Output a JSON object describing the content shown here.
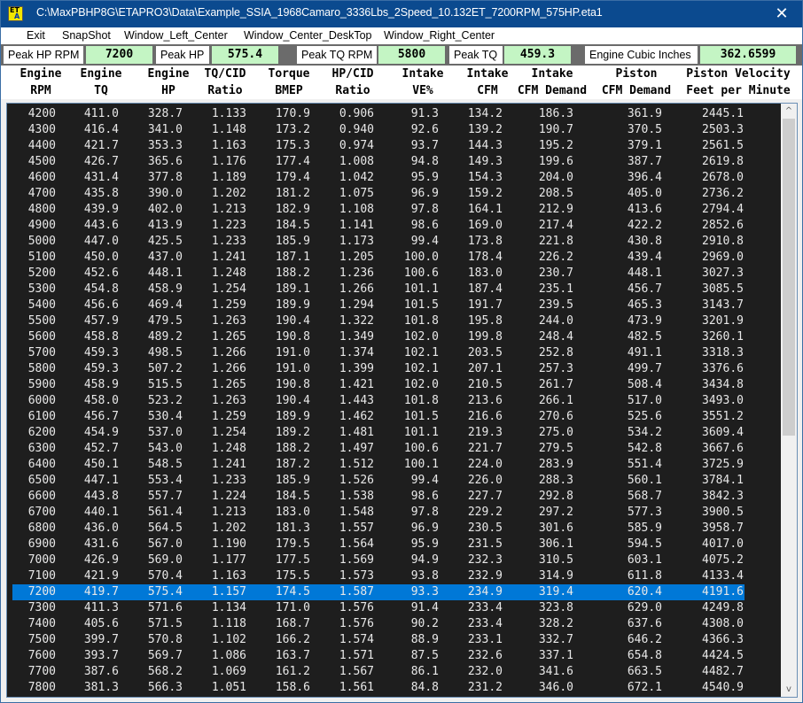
{
  "window": {
    "title": "C:\\MaxPBHP8G\\ETAPRO3\\Data\\Example_SSIA_1968Camaro_3336Lbs_2Speed_10.132ET_7200RPM_575HP.eta1",
    "icon_text_top": "ET",
    "icon_text_bottom": "A",
    "close_glyph": "✕"
  },
  "menu": [
    "Exit",
    "SnapShot",
    "Window_Left_Center",
    "Window_Center_DeskTop",
    "Window_Right_Center"
  ],
  "stats": [
    {
      "label": "Peak HP RPM",
      "value": "7200"
    },
    {
      "label": "Peak HP",
      "value": "575.4"
    },
    {
      "label": "Peak TQ RPM",
      "value": "5800"
    },
    {
      "label": "Peak TQ",
      "value": "459.3"
    },
    {
      "label": "Engine Cubic Inches",
      "value": "362.6599"
    }
  ],
  "columns": [
    {
      "line1": "Engine",
      "line2": "RPM"
    },
    {
      "line1": "Engine",
      "line2": "TQ"
    },
    {
      "line1": "Engine",
      "line2": "HP"
    },
    {
      "line1": "TQ/CID",
      "line2": "Ratio"
    },
    {
      "line1": "Torque",
      "line2": "BMEP"
    },
    {
      "line1": "HP/CID",
      "line2": "Ratio"
    },
    {
      "line1": "Intake",
      "line2": "VE%"
    },
    {
      "line1": "Intake",
      "line2": "CFM"
    },
    {
      "line1": "Intake",
      "line2": "CFM Demand"
    },
    {
      "line1": "Piston",
      "line2": "CFM Demand"
    },
    {
      "line1": "Piston Velocity",
      "line2": "Feet per Minute"
    }
  ],
  "selected_rpm": "7200",
  "rows": [
    [
      "4200",
      "411.0",
      "328.7",
      "1.133",
      "170.9",
      "0.906",
      "91.3",
      "134.2",
      "186.3",
      "361.9",
      "2445.1"
    ],
    [
      "4300",
      "416.4",
      "341.0",
      "1.148",
      "173.2",
      "0.940",
      "92.6",
      "139.2",
      "190.7",
      "370.5",
      "2503.3"
    ],
    [
      "4400",
      "421.7",
      "353.3",
      "1.163",
      "175.3",
      "0.974",
      "93.7",
      "144.3",
      "195.2",
      "379.1",
      "2561.5"
    ],
    [
      "4500",
      "426.7",
      "365.6",
      "1.176",
      "177.4",
      "1.008",
      "94.8",
      "149.3",
      "199.6",
      "387.7",
      "2619.8"
    ],
    [
      "4600",
      "431.4",
      "377.8",
      "1.189",
      "179.4",
      "1.042",
      "95.9",
      "154.3",
      "204.0",
      "396.4",
      "2678.0"
    ],
    [
      "4700",
      "435.8",
      "390.0",
      "1.202",
      "181.2",
      "1.075",
      "96.9",
      "159.2",
      "208.5",
      "405.0",
      "2736.2"
    ],
    [
      "4800",
      "439.9",
      "402.0",
      "1.213",
      "182.9",
      "1.108",
      "97.8",
      "164.1",
      "212.9",
      "413.6",
      "2794.4"
    ],
    [
      "4900",
      "443.6",
      "413.9",
      "1.223",
      "184.5",
      "1.141",
      "98.6",
      "169.0",
      "217.4",
      "422.2",
      "2852.6"
    ],
    [
      "5000",
      "447.0",
      "425.5",
      "1.233",
      "185.9",
      "1.173",
      "99.4",
      "173.8",
      "221.8",
      "430.8",
      "2910.8"
    ],
    [
      "5100",
      "450.0",
      "437.0",
      "1.241",
      "187.1",
      "1.205",
      "100.0",
      "178.4",
      "226.2",
      "439.4",
      "2969.0"
    ],
    [
      "5200",
      "452.6",
      "448.1",
      "1.248",
      "188.2",
      "1.236",
      "100.6",
      "183.0",
      "230.7",
      "448.1",
      "3027.3"
    ],
    [
      "5300",
      "454.8",
      "458.9",
      "1.254",
      "189.1",
      "1.266",
      "101.1",
      "187.4",
      "235.1",
      "456.7",
      "3085.5"
    ],
    [
      "5400",
      "456.6",
      "469.4",
      "1.259",
      "189.9",
      "1.294",
      "101.5",
      "191.7",
      "239.5",
      "465.3",
      "3143.7"
    ],
    [
      "5500",
      "457.9",
      "479.5",
      "1.263",
      "190.4",
      "1.322",
      "101.8",
      "195.8",
      "244.0",
      "473.9",
      "3201.9"
    ],
    [
      "5600",
      "458.8",
      "489.2",
      "1.265",
      "190.8",
      "1.349",
      "102.0",
      "199.8",
      "248.4",
      "482.5",
      "3260.1"
    ],
    [
      "5700",
      "459.3",
      "498.5",
      "1.266",
      "191.0",
      "1.374",
      "102.1",
      "203.5",
      "252.8",
      "491.1",
      "3318.3"
    ],
    [
      "5800",
      "459.3",
      "507.2",
      "1.266",
      "191.0",
      "1.399",
      "102.1",
      "207.1",
      "257.3",
      "499.7",
      "3376.6"
    ],
    [
      "5900",
      "458.9",
      "515.5",
      "1.265",
      "190.8",
      "1.421",
      "102.0",
      "210.5",
      "261.7",
      "508.4",
      "3434.8"
    ],
    [
      "6000",
      "458.0",
      "523.2",
      "1.263",
      "190.4",
      "1.443",
      "101.8",
      "213.6",
      "266.1",
      "517.0",
      "3493.0"
    ],
    [
      "6100",
      "456.7",
      "530.4",
      "1.259",
      "189.9",
      "1.462",
      "101.5",
      "216.6",
      "270.6",
      "525.6",
      "3551.2"
    ],
    [
      "6200",
      "454.9",
      "537.0",
      "1.254",
      "189.2",
      "1.481",
      "101.1",
      "219.3",
      "275.0",
      "534.2",
      "3609.4"
    ],
    [
      "6300",
      "452.7",
      "543.0",
      "1.248",
      "188.2",
      "1.497",
      "100.6",
      "221.7",
      "279.5",
      "542.8",
      "3667.6"
    ],
    [
      "6400",
      "450.1",
      "548.5",
      "1.241",
      "187.2",
      "1.512",
      "100.1",
      "224.0",
      "283.9",
      "551.4",
      "3725.9"
    ],
    [
      "6500",
      "447.1",
      "553.4",
      "1.233",
      "185.9",
      "1.526",
      "99.4",
      "226.0",
      "288.3",
      "560.1",
      "3784.1"
    ],
    [
      "6600",
      "443.8",
      "557.7",
      "1.224",
      "184.5",
      "1.538",
      "98.6",
      "227.7",
      "292.8",
      "568.7",
      "3842.3"
    ],
    [
      "6700",
      "440.1",
      "561.4",
      "1.213",
      "183.0",
      "1.548",
      "97.8",
      "229.2",
      "297.2",
      "577.3",
      "3900.5"
    ],
    [
      "6800",
      "436.0",
      "564.5",
      "1.202",
      "181.3",
      "1.557",
      "96.9",
      "230.5",
      "301.6",
      "585.9",
      "3958.7"
    ],
    [
      "6900",
      "431.6",
      "567.0",
      "1.190",
      "179.5",
      "1.564",
      "95.9",
      "231.5",
      "306.1",
      "594.5",
      "4017.0"
    ],
    [
      "7000",
      "426.9",
      "569.0",
      "1.177",
      "177.5",
      "1.569",
      "94.9",
      "232.3",
      "310.5",
      "603.1",
      "4075.2"
    ],
    [
      "7100",
      "421.9",
      "570.4",
      "1.163",
      "175.5",
      "1.573",
      "93.8",
      "232.9",
      "314.9",
      "611.8",
      "4133.4"
    ],
    [
      "7200",
      "419.7",
      "575.4",
      "1.157",
      "174.5",
      "1.587",
      "93.3",
      "234.9",
      "319.4",
      "620.4",
      "4191.6"
    ],
    [
      "7300",
      "411.3",
      "571.6",
      "1.134",
      "171.0",
      "1.576",
      "91.4",
      "233.4",
      "323.8",
      "629.0",
      "4249.8"
    ],
    [
      "7400",
      "405.6",
      "571.5",
      "1.118",
      "168.7",
      "1.576",
      "90.2",
      "233.4",
      "328.2",
      "637.6",
      "4308.0"
    ],
    [
      "7500",
      "399.7",
      "570.8",
      "1.102",
      "166.2",
      "1.574",
      "88.9",
      "233.1",
      "332.7",
      "646.2",
      "4366.3"
    ],
    [
      "7600",
      "393.7",
      "569.7",
      "1.086",
      "163.7",
      "1.571",
      "87.5",
      "232.6",
      "337.1",
      "654.8",
      "4424.5"
    ],
    [
      "7700",
      "387.6",
      "568.2",
      "1.069",
      "161.2",
      "1.567",
      "86.1",
      "232.0",
      "341.6",
      "663.5",
      "4482.7"
    ],
    [
      "7800",
      "381.3",
      "566.3",
      "1.051",
      "158.6",
      "1.561",
      "84.8",
      "231.2",
      "346.0",
      "672.1",
      "4540.9"
    ]
  ],
  "scrollbar": {
    "up_glyph": "^",
    "down_glyph": "v",
    "thumb_fraction": 0.55
  },
  "colors": {
    "titlebar": "#0b4a8f",
    "stat_value_bg": "#c4f5c4",
    "grid_bg": "#1e1e1e",
    "selection": "#0078d7"
  }
}
